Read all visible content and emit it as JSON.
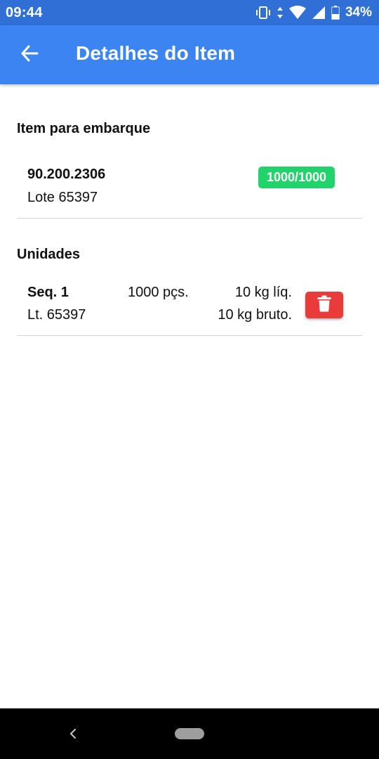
{
  "status_bar": {
    "time": "09:44",
    "battery": "34%",
    "icons": [
      "vibrate-icon",
      "data-arrows-icon",
      "wifi-icon",
      "signal-icon",
      "battery-icon"
    ]
  },
  "app_bar": {
    "title": "Detalhes do Item",
    "back_icon": "arrow-back-icon",
    "color": "#3d84f3"
  },
  "item_section": {
    "title": "Item para embarque",
    "code": "90.200.2306",
    "lot": "Lote 65397",
    "badge": "1000/1000",
    "badge_color": "#22d36b"
  },
  "units_section": {
    "title": "Unidades",
    "units": [
      {
        "seq": "Seq. 1",
        "lot": "Lt. 65397",
        "qty": "1000 pçs.",
        "net": "10 kg líq.",
        "gross": "10 kg bruto.",
        "delete_icon": "trash-icon",
        "delete_color": "#ea3b3b"
      }
    ]
  },
  "nav_bar": {
    "back_icon": "nav-back-icon",
    "home_icon": "home-pill-icon"
  }
}
